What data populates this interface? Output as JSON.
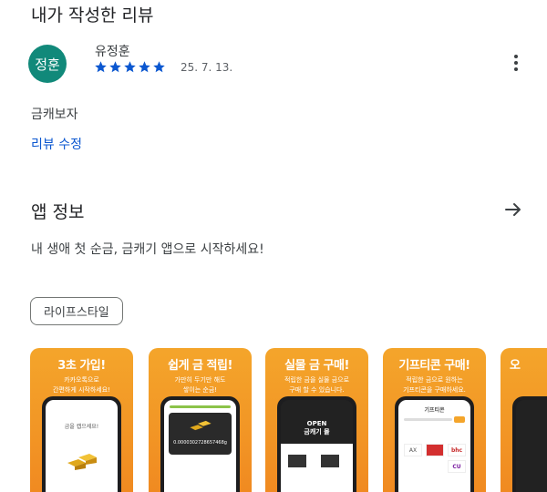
{
  "my_review": {
    "title": "내가 작성한 리뷰",
    "avatar_text": "정훈",
    "avatar_color": "#11897a",
    "reviewer_name": "유정훈",
    "rating": 5,
    "rating_max": 5,
    "star_color": "#0b57d0",
    "date": "25. 7. 13.",
    "more_icon": "more-vert-icon",
    "text": "금캐보자",
    "edit_label": "리뷰 수정"
  },
  "app_info": {
    "title": "앱 정보",
    "arrow_icon": "arrow-right-icon",
    "description": "내 생애 첫 순금, 금캐기 앱으로 시작하세요!",
    "category_chip": "라이프스타일"
  },
  "screenshots": [
    {
      "title": "3초 가입!",
      "subtitle": "카카오톡으로\n간편하게 시작하세요!",
      "screen_text": "금을 캡으세요!"
    },
    {
      "title": "쉽게 금 적립!",
      "subtitle": "가만히 두기만 해도\n쌓이는 순금!",
      "screen_value": "0.0000302728657468g"
    },
    {
      "title": "실물 금 구매!",
      "subtitle": "적립한 금을 실물 금으로\n구매 할 수 있습니다.",
      "screen_text": "OPEN\n금캐기 몰"
    },
    {
      "title": "기프티콘 구매!",
      "subtitle": "적립한 금으로 원하는\n기프티콘을 구매하세요.",
      "screen_text": "기프티콘"
    },
    {
      "title": "오",
      "subtitle": "",
      "screen_text": ""
    }
  ],
  "accent_color": "#f4a52b"
}
